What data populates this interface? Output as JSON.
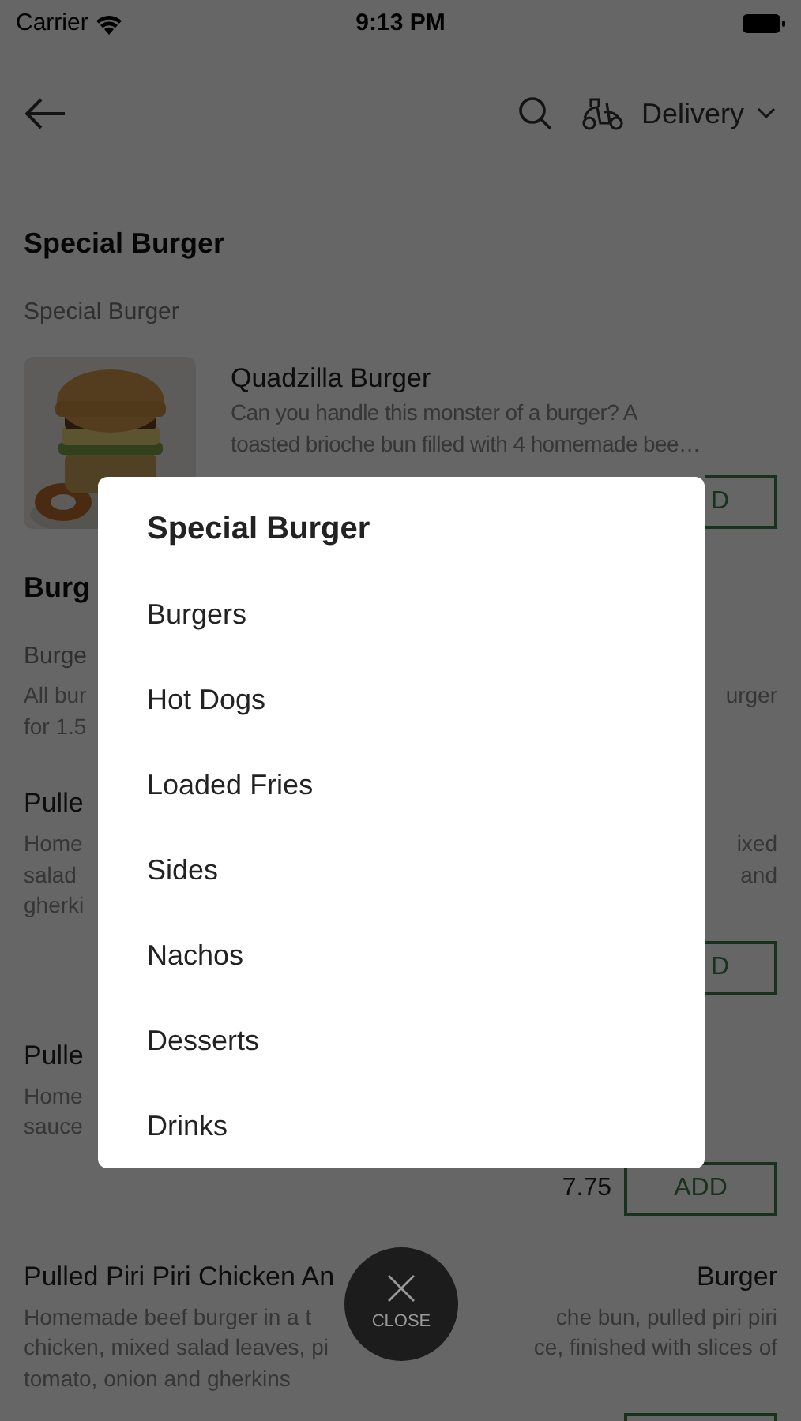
{
  "status_bar": {
    "carrier": "Carrier",
    "time": "9:13 PM"
  },
  "nav": {
    "mode": "Delivery"
  },
  "menu": [
    {
      "kind": "heading",
      "left": "Special Burger"
    },
    {
      "kind": "subheading",
      "left": "Special Burger"
    },
    {
      "kind": "picture_item",
      "title": "Quadzilla Burger",
      "lines": [
        "Can you handle this monster of a burger? A",
        "toasted brioche bun filled with 4 homemade bee…"
      ],
      "add": "D"
    },
    {
      "kind": "heading",
      "left": "Burg"
    },
    {
      "kind": "subheading",
      "left": "Burge"
    },
    {
      "kind": "text",
      "lines": [
        {
          "left": "All bur",
          "right": "urger"
        },
        {
          "left": "for 1.5"
        }
      ]
    },
    {
      "kind": "title",
      "left": "Pulle"
    },
    {
      "kind": "text",
      "lines": [
        {
          "left": "Home",
          "right": "ixed"
        },
        {
          "left": "salad",
          "right": "and"
        },
        {
          "left": "gherki"
        }
      ]
    },
    {
      "kind": "add_row",
      "add": "D"
    },
    {
      "kind": "title",
      "left": "Pulle"
    },
    {
      "kind": "text",
      "lines": [
        {
          "left": "Home"
        },
        {
          "left": "sauce"
        }
      ]
    },
    {
      "kind": "add_row",
      "price": "7.75",
      "add": "ADD"
    },
    {
      "kind": "title",
      "left": "Pulled Piri Piri Chicken An",
      "right": "Burger"
    },
    {
      "kind": "text",
      "lines": [
        {
          "left": "Homemade beef burger in a t",
          "right": "che bun, pulled piri piri"
        },
        {
          "left": "chicken, mixed salad leaves, pi",
          "right": "ce, finished with slices of"
        },
        {
          "left": "tomato, onion and gherkins"
        }
      ]
    },
    {
      "kind": "add_row"
    }
  ],
  "category_menu": {
    "items": [
      {
        "label": "Special Burger",
        "selected": true
      },
      {
        "label": "Burgers",
        "selected": false
      },
      {
        "label": "Hot Dogs",
        "selected": false
      },
      {
        "label": "Loaded Fries",
        "selected": false
      },
      {
        "label": "Sides",
        "selected": false
      },
      {
        "label": "Nachos",
        "selected": false
      },
      {
        "label": "Desserts",
        "selected": false
      },
      {
        "label": "Drinks",
        "selected": false
      }
    ]
  },
  "close_button": {
    "label": "CLOSE"
  }
}
